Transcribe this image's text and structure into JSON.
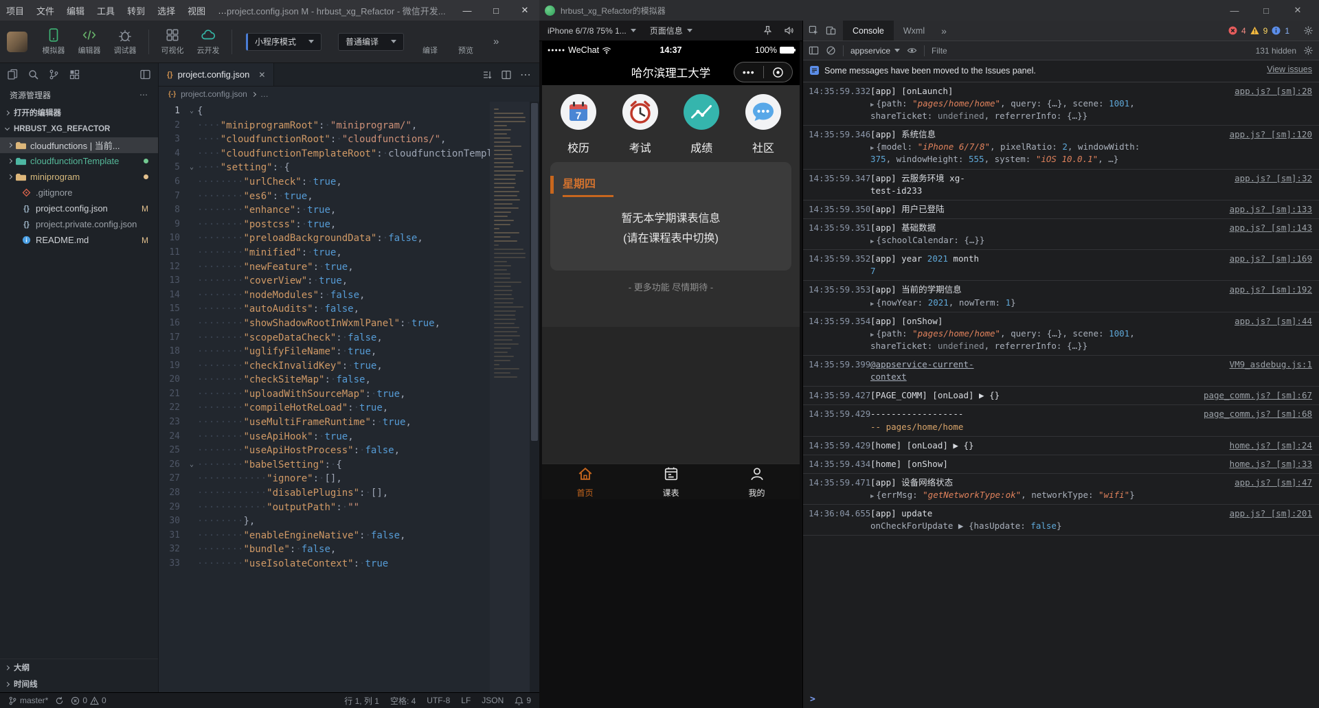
{
  "colors": {
    "accent_orange": "#c8671e",
    "error_red": "#e55c5c",
    "warning_yellow": "#f0b73f",
    "info_blue": "#5b8de8",
    "code_string": "#ce9178",
    "code_bool": "#569cd6"
  },
  "main_window": {
    "titlebar": {
      "menus": [
        "项目",
        "文件",
        "编辑",
        "工具",
        "转到",
        "选择",
        "视图",
        "…"
      ],
      "title": "project.config.json M - hrbust_xg_Refactor - 微信开发...",
      "minimize": "—",
      "maximize": "□",
      "close": "✕"
    },
    "toolbar": {
      "panels": [
        {
          "label": "模拟器",
          "icon": "simulator-icon"
        },
        {
          "label": "编辑器",
          "icon": "editor-icon"
        },
        {
          "label": "调试器",
          "icon": "debugger-icon"
        },
        {
          "label": "可视化",
          "icon": "visualize-icon"
        },
        {
          "label": "云开发",
          "icon": "cloud-dev-icon"
        }
      ],
      "mode_select": "小程序模式",
      "compile_select": "普通编译",
      "compile_label": "编译",
      "preview_label": "预览",
      "more": "»"
    },
    "explorer": {
      "title": "资源管理器",
      "more": "⋯",
      "open_editors": "打开的编辑器",
      "project_name": "HRBUST_XG_REFACTOR",
      "tree": [
        {
          "label": "cloudfunctions | 当前...",
          "icon": "folder",
          "folder_color": "#dcb67a",
          "style": "plain",
          "chevron": true,
          "selected": true
        },
        {
          "label": "cloudfunctionTemplate",
          "icon": "folder",
          "folder_color": "#4db6a2",
          "style": "teal",
          "chevron": true,
          "dot": "#73c991"
        },
        {
          "label": "miniprogram",
          "icon": "folder",
          "folder_color": "#dcb67a",
          "style": "yellow",
          "chevron": true,
          "dot": "#e2c08d"
        },
        {
          "label": ".gitignore",
          "icon": "git",
          "style": "dim"
        },
        {
          "label": "project.config.json",
          "icon": "json",
          "style": "plain",
          "badge": "M"
        },
        {
          "label": "project.private.config.json",
          "icon": "json",
          "style": "dim"
        },
        {
          "label": "README.md",
          "icon": "info",
          "style": "plain",
          "badge": "M"
        }
      ],
      "outline": "大纲",
      "timeline": "时间线"
    },
    "editor": {
      "tab": "project.config.json",
      "tab_close": "✕",
      "breadcrumb_icon": "{-}",
      "breadcrumb_file": "project.config.json",
      "breadcrumb_more": "…",
      "fold_lines": [
        1,
        5,
        26
      ],
      "code_lines": [
        "{",
        "    \"miniprogramRoot\": \"miniprogram/\",",
        "    \"cloudfunctionRoot\": \"cloudfunctions/\",",
        "    \"cloudfunctionTemplateRoot\": \"cloudfunctionTempla",
        "    \"setting\": {",
        "        \"urlCheck\": true,",
        "        \"es6\": true,",
        "        \"enhance\": true,",
        "        \"postcss\": true,",
        "        \"preloadBackgroundData\": false,",
        "        \"minified\": true,",
        "        \"newFeature\": true,",
        "        \"coverView\": true,",
        "        \"nodeModules\": false,",
        "        \"autoAudits\": false,",
        "        \"showShadowRootInWxmlPanel\": true,",
        "        \"scopeDataCheck\": false,",
        "        \"uglifyFileName\": true,",
        "        \"checkInvalidKey\": true,",
        "        \"checkSiteMap\": false,",
        "        \"uploadWithSourceMap\": true,",
        "        \"compileHotReLoad\": true,",
        "        \"useMultiFrameRuntime\": true,",
        "        \"useApiHook\": true,",
        "        \"useApiHostProcess\": false,",
        "        \"babelSetting\": {",
        "            \"ignore\": [],",
        "            \"disablePlugins\": [],",
        "            \"outputPath\": \"\"",
        "        },",
        "        \"enableEngineNative\": false,",
        "        \"bundle\": false,",
        "        \"useIsolateContext\": true"
      ]
    },
    "statusbar": {
      "branch": "master*",
      "errors": "0",
      "warnings": "0",
      "cursor": "行 1, 列 1",
      "spaces": "空格: 4",
      "encoding": "UTF-8",
      "eol": "LF",
      "language": "JSON",
      "bell_count": "9"
    }
  },
  "sim_window": {
    "title": "hrbust_xg_Refactor的模拟器",
    "minimize": "—",
    "maximize": "□",
    "close": "✕",
    "toolbar": {
      "device": "iPhone 6/7/8 75% 1...",
      "page_info": "页面信息"
    },
    "phone": {
      "signal": "●●●●●",
      "carrier": "WeChat",
      "time": "14:37",
      "battery": "100%",
      "nav_title": "哈尔滨理工大学",
      "capsule_dots": "•••",
      "grid": [
        {
          "label": "校历",
          "icon": "calendar-app-icon"
        },
        {
          "label": "考试",
          "icon": "exam-app-icon"
        },
        {
          "label": "成绩",
          "icon": "grades-app-icon"
        },
        {
          "label": "社区",
          "icon": "community-app-icon"
        }
      ],
      "card": {
        "title": "星期四",
        "line1": "暂无本学期课表信息",
        "line2": "(请在课程表中切换)"
      },
      "more_text": "- 更多功能 尽情期待 -",
      "tabbar": [
        {
          "label": "首页",
          "icon": "home-tab-ic",
          "active": true
        },
        {
          "label": "课表",
          "icon": "schedule-tab-ic",
          "active": false
        },
        {
          "label": "我的",
          "icon": "profile-tab-ic",
          "active": false
        }
      ]
    }
  },
  "devtools": {
    "tabs": [
      {
        "label": "Console",
        "active": true
      },
      {
        "label": "Wxml",
        "active": false
      }
    ],
    "more_tabs": "»",
    "badges": {
      "errors": "4",
      "warnings": "9",
      "infos": "1"
    },
    "context": "appservice",
    "filter_placeholder": "Filte",
    "hidden_count": "131 hidden",
    "notice": {
      "text": "Some messages have been moved to the Issues panel.",
      "link": "View issues"
    },
    "prompt": ">",
    "logs": [
      {
        "time": "14:35:59.332",
        "msg": "[app] [onLaunch]",
        "src": "app.js? [sm]:28",
        "arrow": true,
        "detail": "{path: \"pages/home/home\", query: {…}, scene: 1001, shareTicket: undefined, referrerInfo: {…}}"
      },
      {
        "time": "14:35:59.346",
        "msg": "[app] 系统信息",
        "src": "app.js? [sm]:120",
        "arrow": true,
        "detail": "{model: \"iPhone 6/7/8\", pixelRatio: 2, windowWidth: 375, windowHeight: 555, system: \"iOS 10.0.1\", …}"
      },
      {
        "time": "14:35:59.347",
        "msg": "[app] 云服务环境 xg-\ntest-id233",
        "src": "app.js? [sm]:32"
      },
      {
        "time": "14:35:59.350",
        "msg": "[app] 用户已登陆",
        "src": "app.js? [sm]:133"
      },
      {
        "time": "14:35:59.351",
        "msg": "[app] 基础数据",
        "src": "app.js? [sm]:143",
        "arrow": true,
        "detail": "{schoolCalendar: {…}}"
      },
      {
        "time": "14:35:59.352",
        "msg": "[app] year 2021 month\n7",
        "src": "app.js? [sm]:169"
      },
      {
        "time": "14:35:59.353",
        "msg": "[app] 当前的学期信息",
        "src": "app.js? [sm]:192",
        "arrow": true,
        "detail": "{nowYear: 2021, nowTerm: 1}"
      },
      {
        "time": "14:35:59.354",
        "msg": "[app] [onShow]",
        "src": "app.js? [sm]:44",
        "arrow": true,
        "detail": "{path: \"pages/home/home\", query: {…}, scene: 1001, shareTicket: undefined, referrerInfo: {…}}"
      },
      {
        "time": "14:35:59.399",
        "msg": "@appservice-current-\ncontext",
        "src": "VM9_asdebug.js:1",
        "msg_link": true
      },
      {
        "time": "14:35:59.427",
        "msg": "[PAGE_COMM] [onLoad] ▶ {}",
        "src": "page_comm.js? [sm]:67"
      },
      {
        "time": "14:35:59.429",
        "msg": "------------------",
        "src": "page_comm.js? [sm]:68",
        "detail": "-- pages/home/home",
        "detail_str": true
      },
      {
        "time": "14:35:59.429",
        "msg": "[home] [onLoad] ▶ {}",
        "src": "home.js? [sm]:24"
      },
      {
        "time": "14:35:59.434",
        "msg": "[home] [onShow]",
        "src": "home.js? [sm]:33"
      },
      {
        "time": "14:35:59.471",
        "msg": "[app] 设备网络状态",
        "src": "app.js? [sm]:47",
        "arrow": true,
        "detail": "{errMsg: \"getNetworkType:ok\", networkType: \"wifi\"}"
      },
      {
        "time": "14:36:04.655",
        "msg": "[app] update",
        "src": "app.js? [sm]:201",
        "detail": "onCheckForUpdate ▶ {hasUpdate: false}"
      }
    ]
  }
}
